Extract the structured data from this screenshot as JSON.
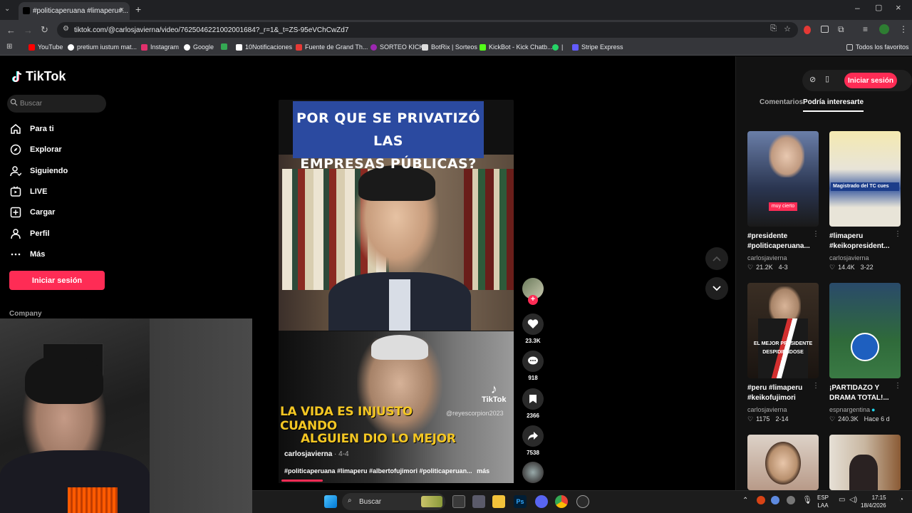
{
  "browser": {
    "tab_title": "#politicaperuana #limaperu#...",
    "url": "tiktok.com/@carlosjavierna/video/7625046221002001684?_r=1&_t=ZS-95eVChCwZd7",
    "bookmarks": [
      {
        "label": "YouTube",
        "color": "#ff0000"
      },
      {
        "label": "pretium iustum mat...",
        "color": "#ffffff"
      },
      {
        "label": "Instagram",
        "color": "#e1306c"
      },
      {
        "label": "Google",
        "color": "#4285f4"
      },
      {
        "label": "",
        "color": "#34a853"
      },
      {
        "label": "10Notificaciones",
        "color": "#ffffff"
      },
      {
        "label": "Fuente de Grand Th...",
        "color": "#e53935"
      },
      {
        "label": "SORTEO KICK",
        "color": "#9c27b0"
      },
      {
        "label": "BotRix | Sorteos",
        "color": "#dddddd"
      },
      {
        "label": "KickBot - Kick Chatb...",
        "color": "#53fc18"
      },
      {
        "label": "|",
        "color": "#25d366"
      },
      {
        "label": "Stripe Express",
        "color": "#635bff"
      }
    ],
    "all_favorites": "Todos los favoritos"
  },
  "tiktok": {
    "logo": "TikTok",
    "search_placeholder": "Buscar",
    "nav": [
      {
        "label": "Para ti",
        "icon": "home-icon"
      },
      {
        "label": "Explorar",
        "icon": "compass-icon"
      },
      {
        "label": "Siguiendo",
        "icon": "following-icon"
      },
      {
        "label": "LIVE",
        "icon": "live-icon"
      },
      {
        "label": "Cargar",
        "icon": "upload-icon"
      },
      {
        "label": "Perfil",
        "icon": "profile-icon"
      },
      {
        "label": "Más",
        "icon": "more-icon"
      }
    ],
    "login_button": "Iniciar sesión",
    "company_label": "Company"
  },
  "video": {
    "title_line1": "POR QUE SE PRIVATIZÓ LAS",
    "title_line2": "EMPRESAS PÚBLICAS?",
    "caption_line1": "LA VIDA ES INJUSTO CUANDO",
    "caption_line2": "ALGUIEN DIO LO MEJOR",
    "watermark": "TikTok",
    "watermark_user": "@reyescorpion2023",
    "author": "carlosjavierna",
    "date": "· 4-4",
    "tags": "#politicaperuana #limaperu #albertofujimori #politicaperuan...",
    "more": "más",
    "progress": 0.18
  },
  "actions": {
    "likes": "23.3K",
    "comments": "918",
    "saves": "2366",
    "shares": "7538"
  },
  "right_panel": {
    "login_button": "Iniciar sesión",
    "tabs": [
      "Comentarios",
      "Podría interesarte"
    ],
    "active_tab": 1,
    "items": [
      {
        "title_l1": "#presidente",
        "title_l2": "#politicaperuana...",
        "user": "carlosjavierna",
        "likes": "21.2K",
        "date": "4-3",
        "thumb_text": "muy cierto",
        "thumb_color": "#3a4a6a"
      },
      {
        "title_l1": "#limaperu",
        "title_l2": "#keikopresident...",
        "user": "carlosjavierna",
        "likes": "14.4K",
        "date": "3-22",
        "thumb_text": "Magistrado del TC cues",
        "thumb_color": "#e8e4d8"
      },
      {
        "title_l1": "#peru #limaperu",
        "title_l2": "#keikofujimori",
        "user": "carlosjavierna",
        "likes": "1175",
        "date": "2-14",
        "thumb_text": "EL MEJOR PRESIDENTE DESPIDIENDOSE",
        "thumb_color": "#2a2018"
      },
      {
        "title_l1": "¡PARTIDAZO Y",
        "title_l2": "DRAMA TOTAL!...",
        "user": "espnargentina",
        "likes": "240.3K",
        "date": "Hace 6 d",
        "thumb_text": "",
        "thumb_color": "#2f6a3a"
      },
      {
        "title_l1": "",
        "title_l2": "",
        "user": "",
        "likes": "",
        "date": "",
        "thumb_text": "",
        "thumb_color": "#c9b6a8"
      },
      {
        "title_l1": "",
        "title_l2": "",
        "user": "",
        "likes": "",
        "date": "",
        "thumb_text": "",
        "thumb_color": "#bdb3a6"
      }
    ]
  },
  "taskbar": {
    "search_placeholder": "Buscar",
    "lang_line1": "ESP",
    "lang_line2": "LAA",
    "time": "17:15",
    "date": "18/4/2026"
  },
  "colors": {
    "accent": "#fe2c55",
    "title_box": "#2b4aa0",
    "caption": "#f3c623"
  }
}
